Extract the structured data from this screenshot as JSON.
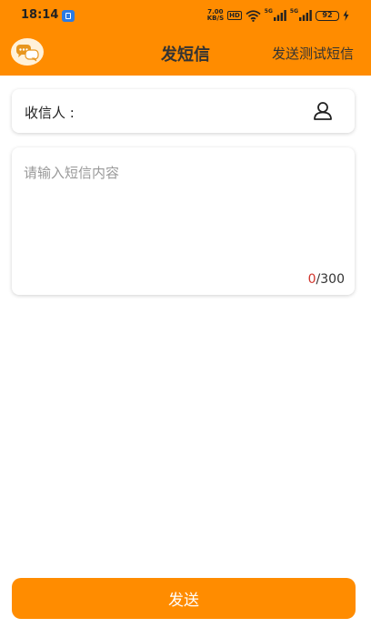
{
  "status_bar": {
    "time": "18:14",
    "net_speed_value": "7.00",
    "net_speed_unit": "KB/S",
    "hd_label": "HD",
    "signal_label": "5G",
    "battery_level": "92"
  },
  "header": {
    "title": "发短信",
    "action_label": "发送测试短信"
  },
  "recipient": {
    "label": "收信人 :",
    "value": ""
  },
  "message": {
    "placeholder": "请输入短信内容",
    "value": "",
    "char_count": "0",
    "char_separator": "/",
    "char_limit": "300"
  },
  "actions": {
    "send_label": "发送"
  },
  "colors": {
    "accent": "#FF8C00",
    "counter_highlight": "#D0342C"
  }
}
